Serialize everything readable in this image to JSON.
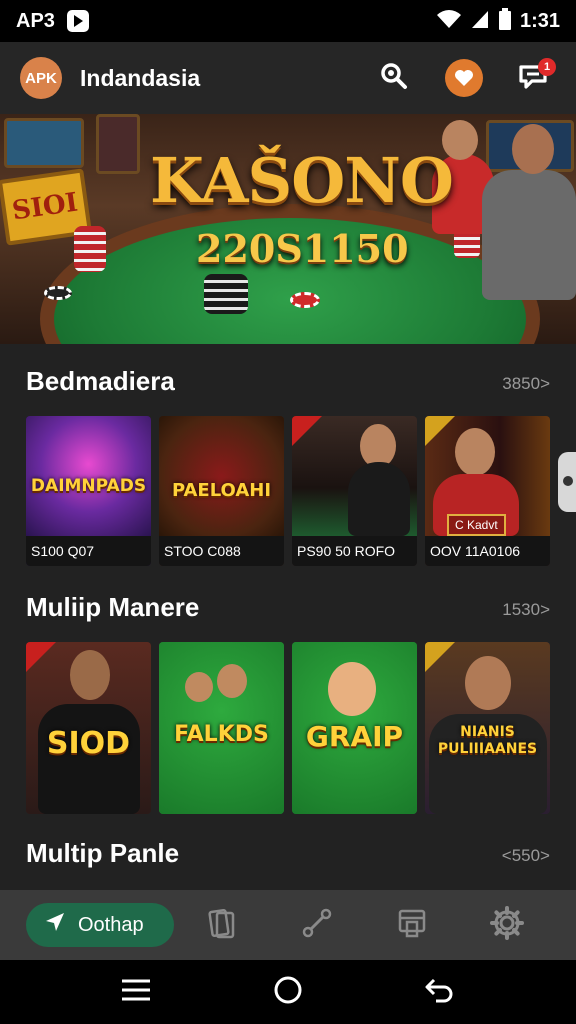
{
  "status_bar": {
    "carrier": "AP3",
    "time": "1:31",
    "icons": [
      "app-notification-icon",
      "wifi-icon",
      "signal-icon",
      "battery-icon"
    ]
  },
  "header": {
    "logo_text": "APK",
    "title": "Indandasia",
    "notification_count": "1",
    "icons": [
      "search-icon",
      "heart-icon",
      "chat-icon"
    ]
  },
  "hero": {
    "title": "KAŠONO",
    "subtitle": "220S1150",
    "sign_text": "SIOI"
  },
  "sections": [
    {
      "title": "Bedmadiera",
      "count": "3850>",
      "cards": [
        {
          "label": "DAIMNPADS",
          "caption": "S100 Q07"
        },
        {
          "label": "PAELOAHI",
          "caption": "STOO C088"
        },
        {
          "label": "",
          "caption": "PS90 50 ROFO"
        },
        {
          "label": "C Kadvt",
          "caption": "OOV 11A0106"
        }
      ]
    },
    {
      "title": "Muliip Manere",
      "count": "1530>",
      "cards": [
        {
          "label": "SIOD",
          "caption": ""
        },
        {
          "label": "FALKDS",
          "caption": ""
        },
        {
          "label": "GRAIP",
          "caption": ""
        },
        {
          "label": "NIANIS PULIIIAANES",
          "caption": ""
        }
      ]
    },
    {
      "title": "Multip Panle",
      "count": "<550>"
    }
  ],
  "bottom_nav": {
    "active_label": "Oothap",
    "items": [
      "navigate-icon",
      "cards-icon",
      "connect-icon",
      "layout-icon",
      "settings-icon"
    ]
  },
  "colors": {
    "background": "#222222",
    "header": "#262626",
    "accent_green": "#1f6a4a",
    "accent_orange": "#e07a2e",
    "badge_red": "#e02a2a",
    "gold_text": "#f5b93a"
  }
}
